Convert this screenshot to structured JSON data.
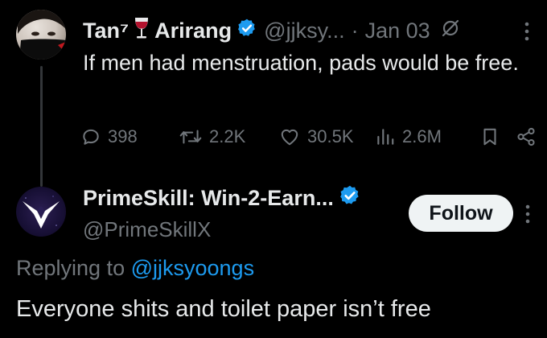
{
  "tweet": {
    "display_name": "Tan⁷",
    "glass_emoji": "wine-glass-emoji",
    "display_name_2": "Arirang",
    "handle": "@jjksy...",
    "separator": "·",
    "date": "Jan 03",
    "text": "If men had menstruation, pads would be free.",
    "stats": {
      "replies": "398",
      "retweets": "2.2K",
      "likes": "30.5K",
      "views": "2.6M"
    }
  },
  "reply": {
    "display_name": "PrimeSkill: Win-2-Earn...",
    "handle": "@PrimeSkillX",
    "follow_label": "Follow",
    "replying_prefix": "Replying to ",
    "replying_to": "@jjksyoongs",
    "text": "Everyone shits and toilet paper isn’t free"
  },
  "colors": {
    "background": "#000000",
    "text_primary": "#e7e9ea",
    "text_secondary": "#71767b",
    "accent_blue": "#1d9bf0",
    "follow_bg": "#eff3f4",
    "verified": "#1d9bf0"
  },
  "icons": [
    "reply-icon",
    "retweet-icon",
    "like-icon",
    "views-icon",
    "bookmark-icon",
    "share-icon",
    "verified-badge-icon",
    "muted-icon",
    "more-icon",
    "wine-glass-icon"
  ]
}
